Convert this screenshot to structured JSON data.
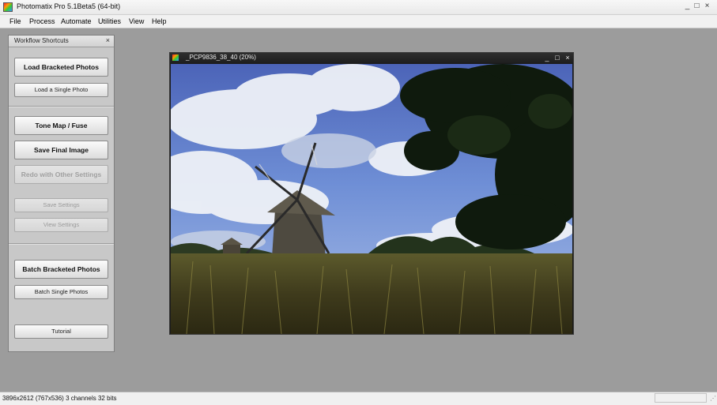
{
  "window": {
    "title": "Photomatix Pro 5.1Beta5 (64-bit)",
    "controls": {
      "minimize": "_",
      "maximize": "□",
      "close": "×"
    }
  },
  "menu": {
    "items": [
      "File",
      "Process",
      "Automate",
      "Utilities",
      "View",
      "Help"
    ]
  },
  "workflow_panel": {
    "title": "Workflow Shortcuts",
    "close": "×",
    "buttons": {
      "load_bracketed": "Load Bracketed Photos",
      "load_single": "Load a Single Photo",
      "tone_map": "Tone Map / Fuse",
      "save_final": "Save Final Image",
      "redo": "Redo with Other Settings",
      "save_settings": "Save Settings",
      "view_settings": "View Settings",
      "batch_bracketed": "Batch Bracketed Photos",
      "batch_single": "Batch Single Photos",
      "tutorial": "Tutorial"
    }
  },
  "image_window": {
    "title": "_PCP9836_38_40 (20%)",
    "controls": {
      "minimize": "_",
      "maximize": "□",
      "close": "×"
    },
    "image_description": "HDR photo of a wooden windmill in a grass field with a tree on the right under a blue sky with clouds"
  },
  "status_bar": {
    "text": "3896x2612 (767x536) 3 channels 32 bits"
  },
  "colors": {
    "workspace": "#9c9c9c",
    "panel": "#c8c8c8",
    "image_titlebar": "#1e1e1e"
  }
}
